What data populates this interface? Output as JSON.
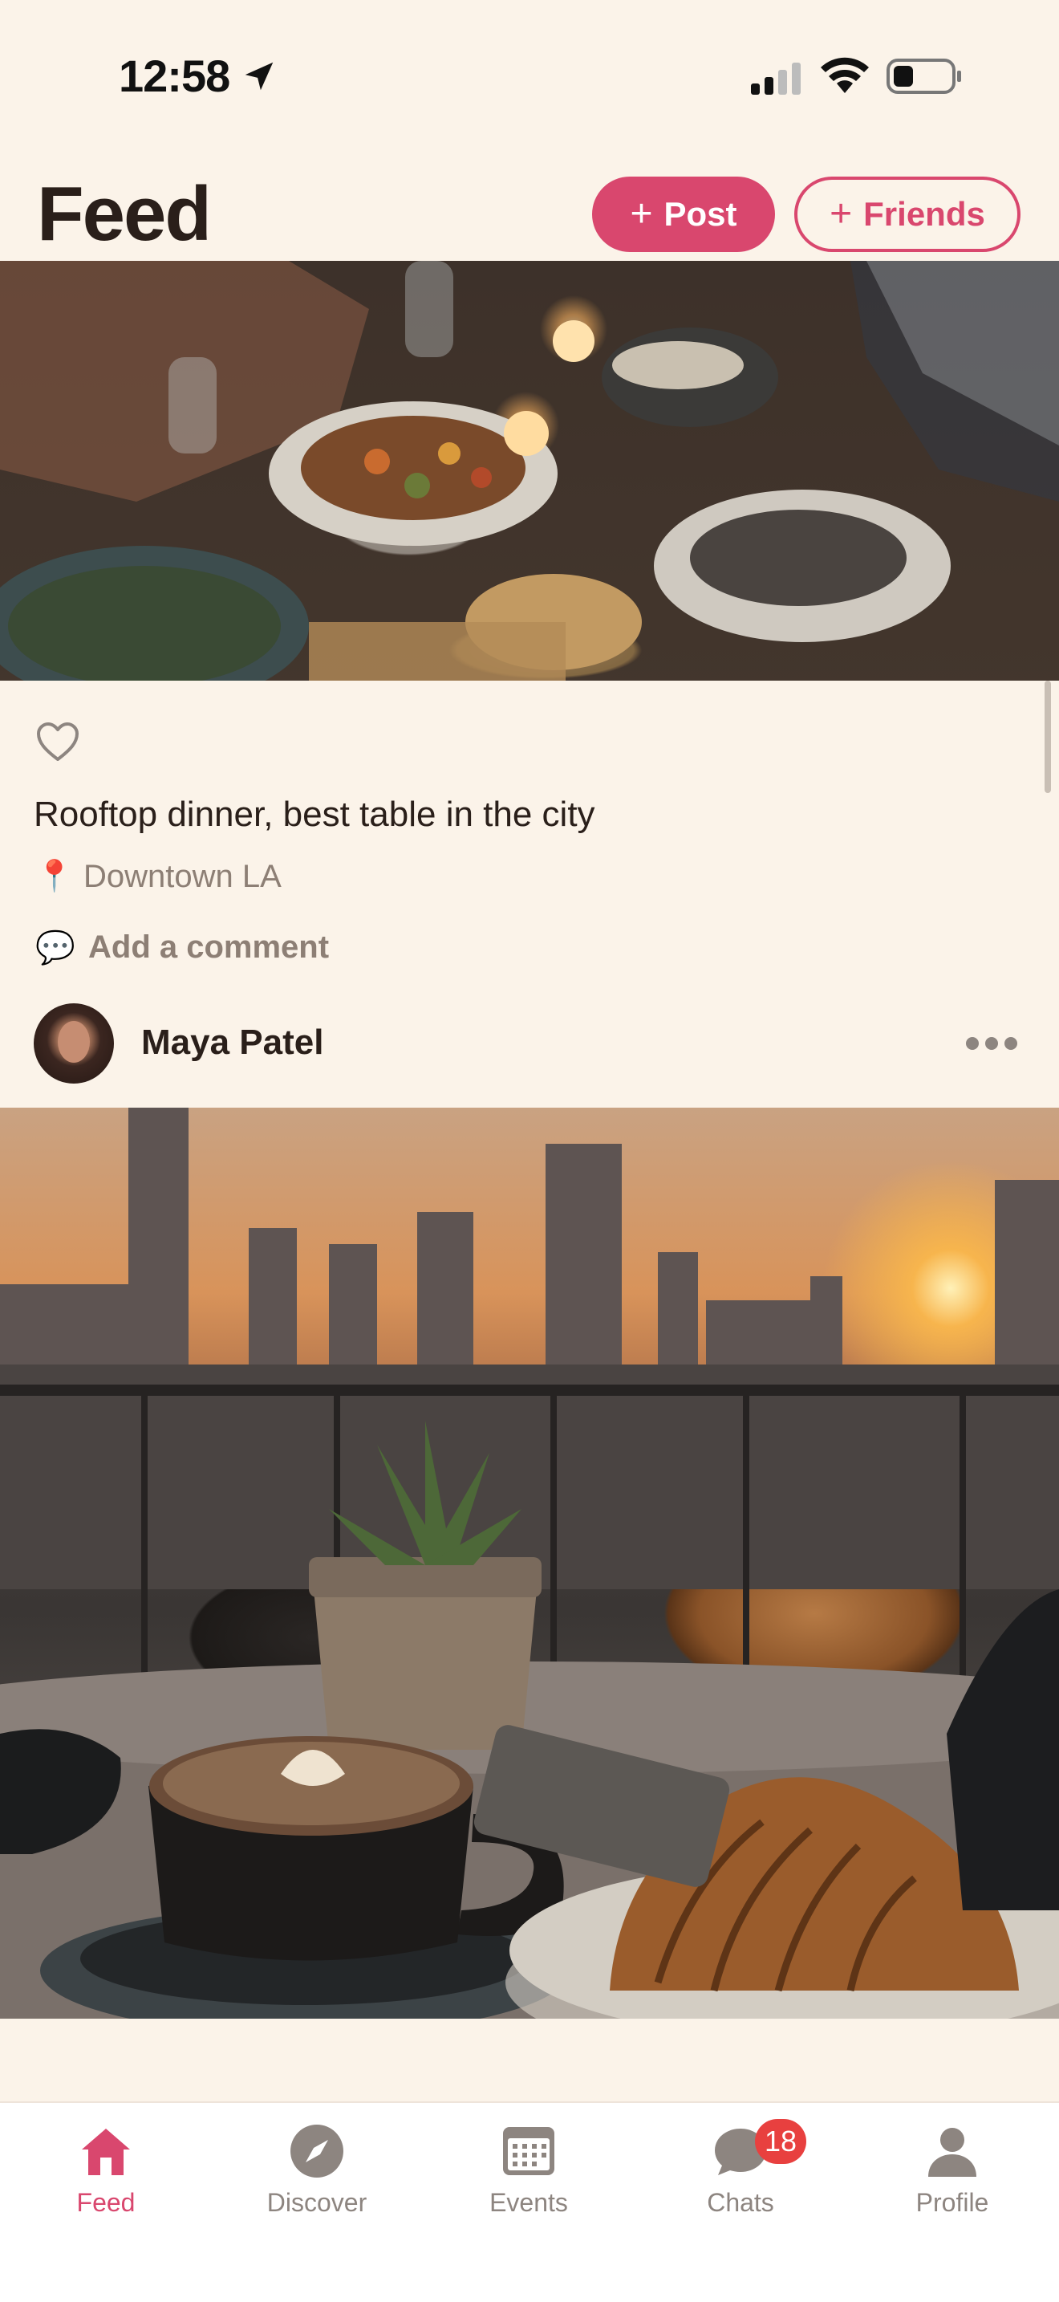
{
  "status_bar": {
    "time": "12:58",
    "icons": [
      "location-arrow-icon",
      "signal-icon",
      "wifi-icon",
      "battery-icon"
    ]
  },
  "header": {
    "title": "Feed",
    "post_button": {
      "icon": "+",
      "label": "Post"
    },
    "friends_button": {
      "icon": "+",
      "label": "Friends"
    }
  },
  "post": {
    "image_subject": "dinner-table-photo",
    "like_icon": "heart-outline-icon",
    "caption": "Rooftop dinner, best table in the city",
    "location": {
      "icon": "📍",
      "text": "Downtown LA"
    },
    "comment": {
      "icon": "💬",
      "label": "Add a comment"
    }
  },
  "next_post": {
    "author_name": "Maya Patel",
    "more_icon": "ellipsis-icon",
    "image_subject": "rooftop-cafe-sunset-photo"
  },
  "tab_bar": {
    "items": [
      {
        "label": "Feed",
        "icon": "home-icon",
        "active": true
      },
      {
        "label": "Discover",
        "icon": "compass-icon",
        "active": false
      },
      {
        "label": "Events",
        "icon": "calendar-icon",
        "active": false
      },
      {
        "label": "Chats",
        "icon": "chat-bubble-icon",
        "active": false,
        "badge": "18"
      },
      {
        "label": "Profile",
        "icon": "person-icon",
        "active": false
      }
    ]
  },
  "colors": {
    "background": "#fbf3e9",
    "accent": "#d9476e",
    "badge": "#e8403f",
    "muted_text": "#8d7f75",
    "text": "#2a1f1a"
  }
}
